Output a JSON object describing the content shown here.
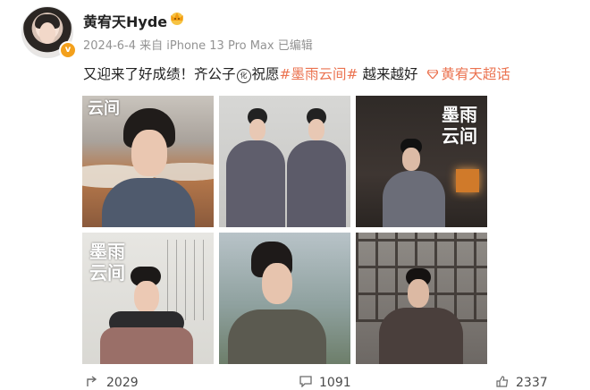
{
  "user": {
    "name": "黄宥天Hyde",
    "meta": "2024-6-4  来自 iPhone 13 Pro Max 已编辑"
  },
  "post": {
    "text_before": "又迎来了好成绩！齐公子",
    "circled_char": "化",
    "text_mid": "祝愿",
    "hashtag": "#墨雨云间#",
    "text_after": " 越来越好",
    "super_topic": "黄宥天超话"
  },
  "images": {
    "titles": [
      "云间",
      "墨雨",
      "云间",
      "墨雨",
      "云间"
    ]
  },
  "footer": {
    "share_count": "2029",
    "comment_count": "1091",
    "like_count": "2337"
  },
  "colors": {
    "accent": "#eb7350",
    "meta_gray": "#939393",
    "badge_orange": "#f3a01c"
  }
}
